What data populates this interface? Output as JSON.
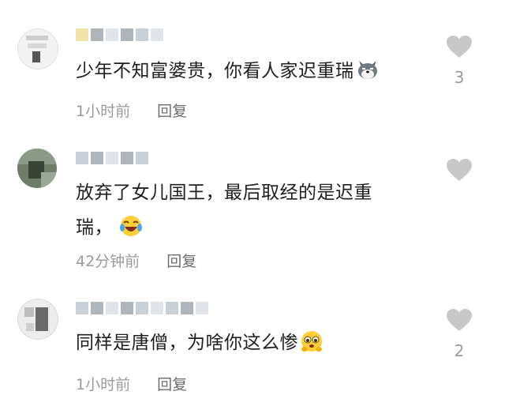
{
  "comments": [
    {
      "text": "少年不知富婆贵，你看人家迟重瑞",
      "emoji": "doge-icon",
      "time": "1小时前",
      "reply": "回复",
      "likes": "3"
    },
    {
      "text_line1": "放弃了女儿国王，最后取经的是迟重",
      "text_line2": "瑞，",
      "emoji": "laugh-cry-icon",
      "time": "42分钟前",
      "reply": "回复",
      "likes": ""
    },
    {
      "text": "同样是唐僧，为啥你这么惨",
      "emoji": "pleading-icon",
      "time": "1小时前",
      "reply": "回复",
      "likes": "2"
    }
  ],
  "colors": {
    "heart": "#c8c8c8",
    "meta": "#9a9a9a",
    "reply": "#6d6d6d"
  }
}
